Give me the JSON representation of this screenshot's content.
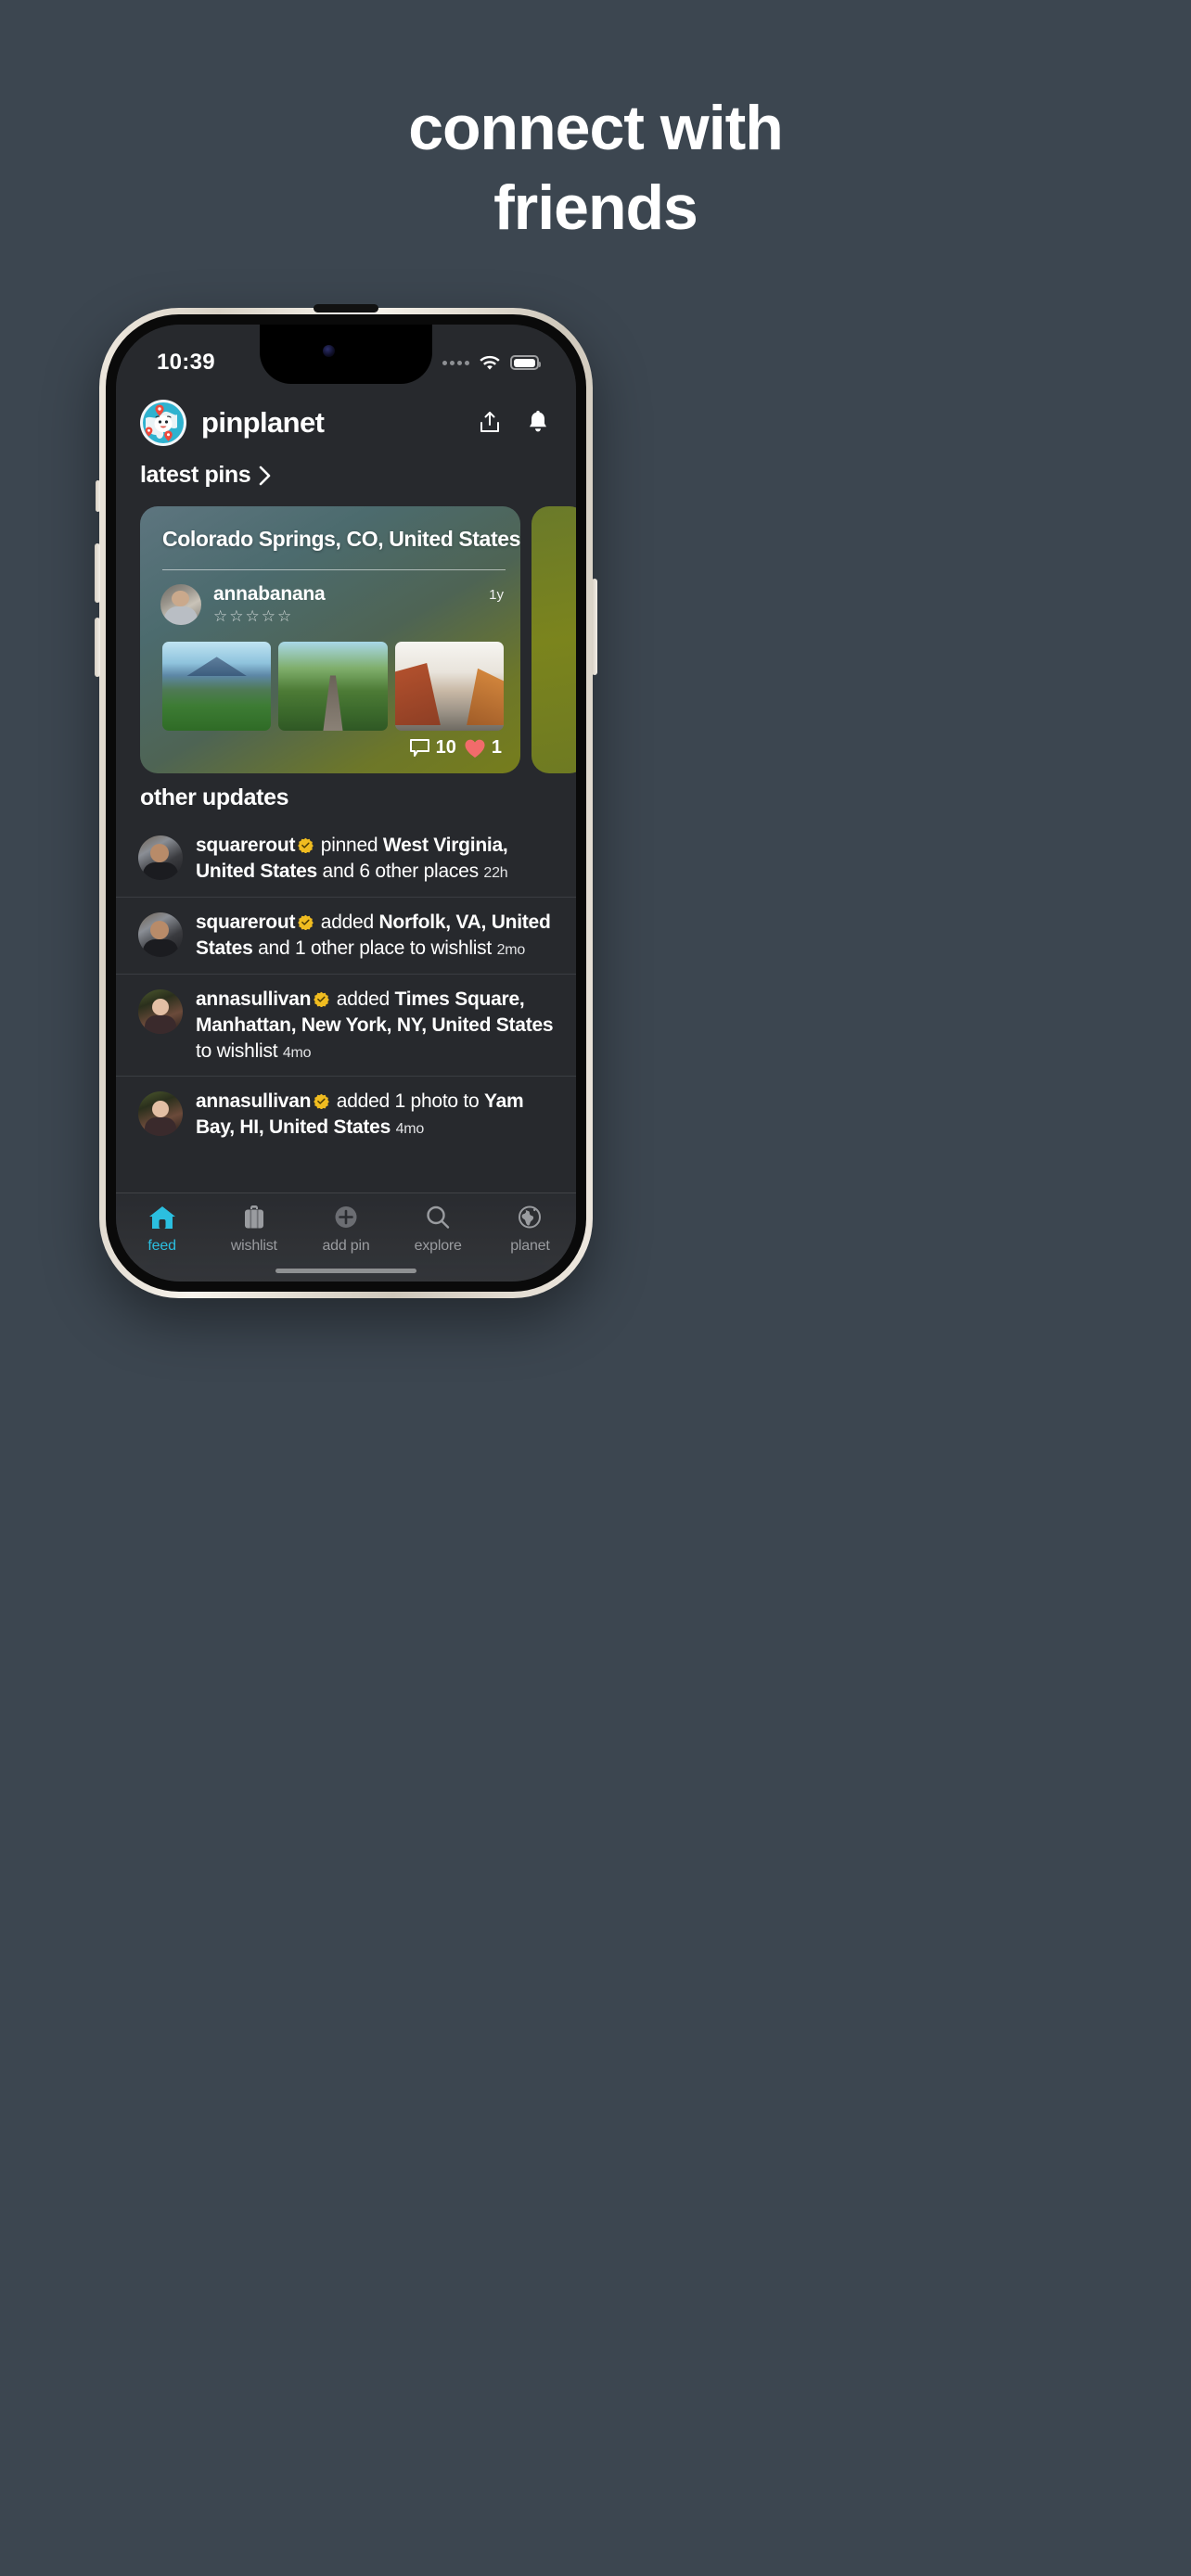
{
  "marketing": {
    "headline_line1": "connect with",
    "headline_line2": "friends",
    "background_color": "#3c4650"
  },
  "statusbar": {
    "time": "10:39",
    "wifi_icon": "wifi-icon",
    "battery_icon": "battery-icon",
    "signal_icon": "signal-dots-icon"
  },
  "header": {
    "logo_icon": "pinplanet-globe-logo",
    "brand": "pinplanet",
    "share_icon": "share-upload-icon",
    "bell_icon": "notification-bell-icon"
  },
  "latest_pins": {
    "title": "latest pins",
    "chevron_icon": "chevron-right-icon",
    "card": {
      "location": "Colorado Springs, CO, United States",
      "username": "annabanana",
      "rating_stars": "☆☆☆☆☆",
      "rating_value": 0,
      "timestamp": "1y",
      "comment_icon": "comment-bubble-icon",
      "comment_count": "10",
      "heart_icon": "heart-icon",
      "heart_count": "1",
      "heart_color": "#f26b6b",
      "photos": [
        {
          "name": "mountain-city-forest-photo"
        },
        {
          "name": "forest-trail-photo"
        },
        {
          "name": "red-rock-canyon-photo"
        }
      ]
    }
  },
  "other_updates": {
    "title": "other updates",
    "items": [
      {
        "avatar": "squarerout-avatar",
        "user": "squarerout",
        "verified": true,
        "action": " pinned ",
        "place": "West Virginia, United States",
        "suffix": " and 6 other places ",
        "time": "22h"
      },
      {
        "avatar": "squarerout-avatar",
        "user": "squarerout",
        "verified": true,
        "action": " added ",
        "place": "Norfolk, VA, United States",
        "suffix": " and 1 other place to wishlist ",
        "time": "2mo"
      },
      {
        "avatar": "annasullivan-avatar",
        "user": "annasullivan",
        "verified": true,
        "action": " added ",
        "place": "Times Square, Manhattan, New York, NY, United States",
        "suffix": " to wishlist ",
        "time": "4mo"
      },
      {
        "avatar": "annasullivan-avatar",
        "user": "annasullivan",
        "verified": true,
        "action": " added 1 photo to ",
        "place": "Yam Bay, HI, United States",
        "suffix": " ",
        "time": "4mo"
      }
    ]
  },
  "tabbar": {
    "active_color": "#2bbfe0",
    "inactive_color": "#9a9ca0",
    "tabs": [
      {
        "label": "feed",
        "icon": "home-icon",
        "active": true
      },
      {
        "label": "wishlist",
        "icon": "suitcase-icon",
        "active": false
      },
      {
        "label": "add pin",
        "icon": "plus-circle-icon",
        "active": false
      },
      {
        "label": "explore",
        "icon": "search-icon",
        "active": false
      },
      {
        "label": "planet",
        "icon": "globe-icon",
        "active": false
      }
    ]
  }
}
